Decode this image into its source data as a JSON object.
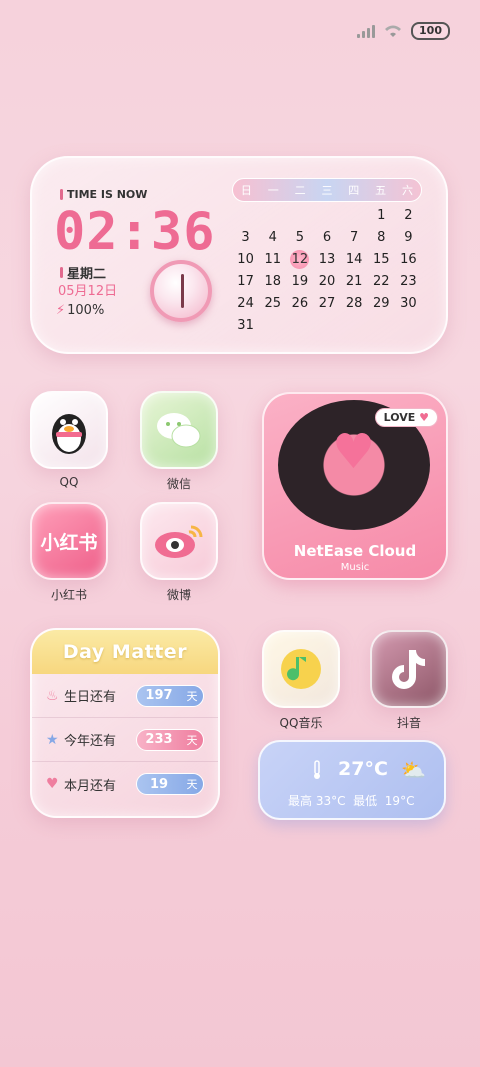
{
  "status": {
    "battery": "100"
  },
  "clock": {
    "label": "TIME IS NOW",
    "time": "02:36",
    "weekday": "星期二",
    "date": "05月12日",
    "battery": "100%",
    "week_headers": [
      "日",
      "一",
      "二",
      "三",
      "四",
      "五",
      "六"
    ],
    "days": [
      "",
      "",
      "",
      "",
      "",
      "1",
      "2",
      "3",
      "4",
      "5",
      "6",
      "7",
      "8",
      "9",
      "10",
      "11",
      "12",
      "13",
      "14",
      "15",
      "16",
      "17",
      "18",
      "19",
      "20",
      "21",
      "22",
      "23",
      "24",
      "25",
      "26",
      "27",
      "28",
      "29",
      "30",
      "31"
    ],
    "today": "12"
  },
  "apps": {
    "qq": "QQ",
    "wechat": "微信",
    "xiaohongshu": "小红书",
    "xiaohongshu_icon_text": "小红书",
    "weibo": "微博",
    "qqmusic": "QQ音乐",
    "douyin": "抖音"
  },
  "music": {
    "badge": "LOVE",
    "title": "NetEase Cloud",
    "subtitle": "Music"
  },
  "daymatter": {
    "title": "Day Matter",
    "rows": [
      {
        "label": "生日还有",
        "value": "197",
        "unit": "天"
      },
      {
        "label": "今年还有",
        "value": "233",
        "unit": "天"
      },
      {
        "label": "本月还有",
        "value": "19",
        "unit": "天"
      }
    ]
  },
  "weather": {
    "temp": "27°C",
    "high_label": "最高",
    "high": "33°C",
    "low_label": "最低",
    "low": "19°C"
  }
}
